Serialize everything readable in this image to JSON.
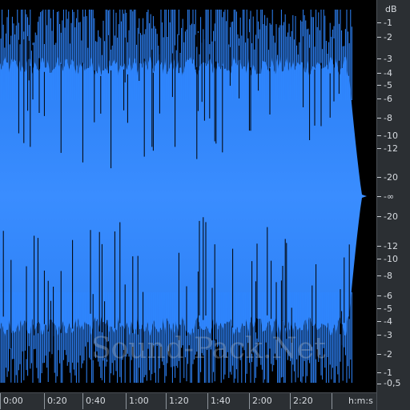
{
  "watermark": "Sound-Pack.Net",
  "colors": {
    "waveform_fill": "#2f86ff",
    "waveform_peaks": "#2f86ff",
    "background": "#000000",
    "scale_panel": "#2b2f33",
    "scale_text": "#d7dbe0"
  },
  "db_scale": {
    "unit": "dB",
    "top_labels": [
      "-1",
      "-2",
      "-3",
      "-4",
      "-5",
      "-6",
      "-8",
      "-10",
      "-12",
      "-20"
    ],
    "center_label": "-∞",
    "bottom_labels": [
      "-20",
      "-12",
      "-10",
      "-8",
      "-6",
      "-5",
      "-4",
      "-3",
      "-2",
      "-1",
      "-0,5"
    ]
  },
  "time_axis": {
    "labels": [
      "0:00",
      "0:20",
      "0:40",
      "1:00",
      "1:20",
      "1:40",
      "2:00",
      "2:20"
    ],
    "unit_label": "h:m:s"
  }
}
